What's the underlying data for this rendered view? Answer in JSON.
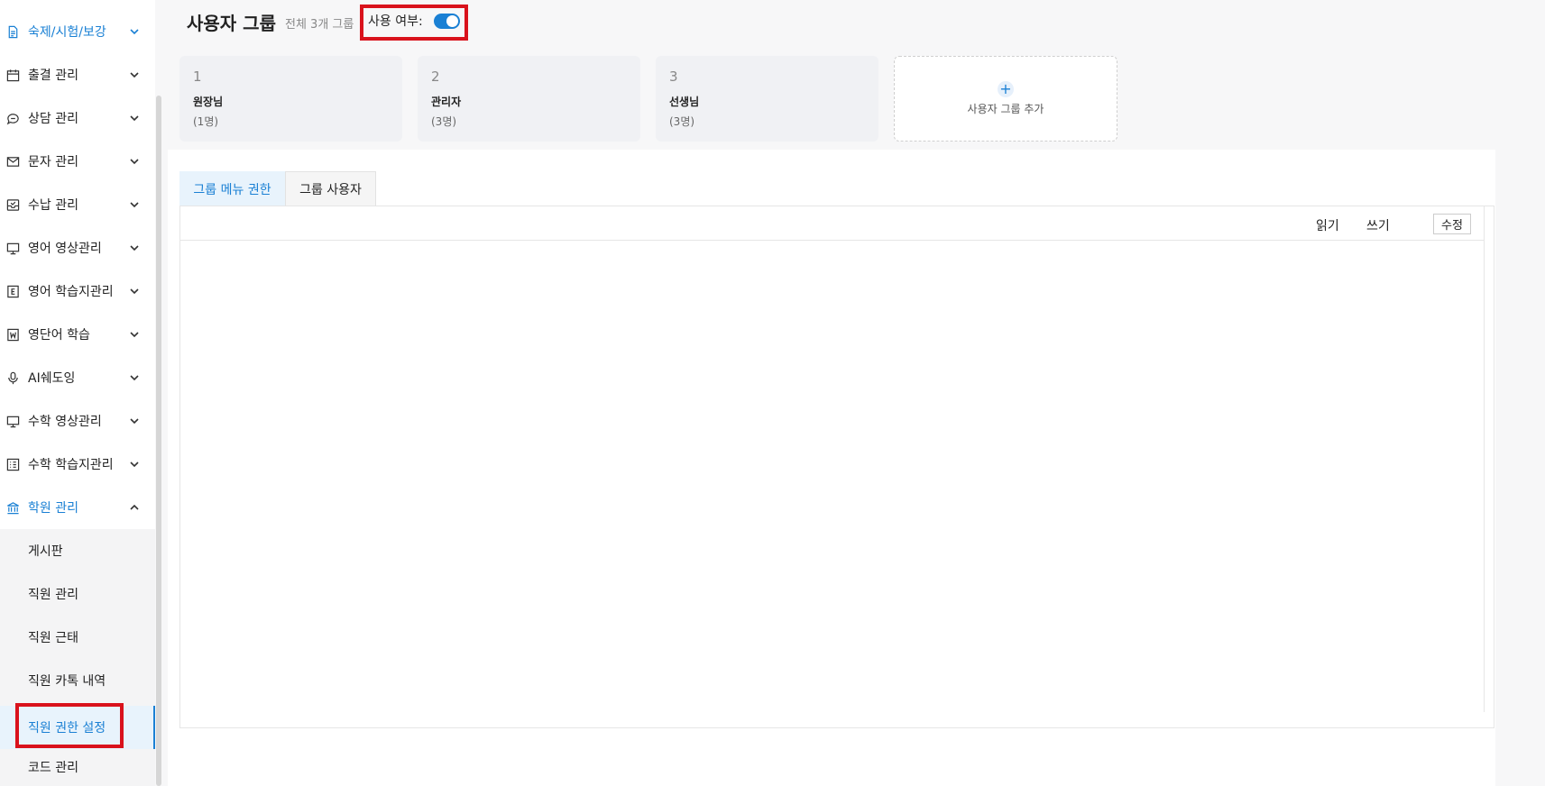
{
  "sidebar": {
    "items": [
      {
        "label": "숙제/시험/보강",
        "icon": "document-icon",
        "expanded": false,
        "active": true
      },
      {
        "label": "출결 관리",
        "icon": "calendar-icon",
        "expanded": false
      },
      {
        "label": "상담 관리",
        "icon": "chat-icon",
        "expanded": false
      },
      {
        "label": "문자 관리",
        "icon": "mail-icon",
        "expanded": false
      },
      {
        "label": "수납 관리",
        "icon": "inbox-icon",
        "expanded": false
      },
      {
        "label": "영어 영상관리",
        "icon": "monitor-icon",
        "expanded": false
      },
      {
        "label": "영어 학습지관리",
        "icon": "e-book-icon",
        "expanded": false
      },
      {
        "label": "영단어 학습",
        "icon": "w-book-icon",
        "expanded": false
      },
      {
        "label": "AI쉐도잉",
        "icon": "microphone-icon",
        "expanded": false
      },
      {
        "label": "수학 영상관리",
        "icon": "monitor-icon",
        "expanded": false
      },
      {
        "label": "수학 학습지관리",
        "icon": "grid-icon",
        "expanded": false
      },
      {
        "label": "학원 관리",
        "icon": "institution-icon",
        "expanded": true,
        "active": true
      }
    ],
    "subitems": [
      {
        "label": "게시판"
      },
      {
        "label": "직원 관리"
      },
      {
        "label": "직원 근태"
      },
      {
        "label": "직원 카톡 내역"
      },
      {
        "label": "직원 권한 설정",
        "active": true
      },
      {
        "label": "코드 관리"
      }
    ]
  },
  "header": {
    "title": "사용자 그룹",
    "count_text": "전체 3개 그룹",
    "use_label": "사용 여부:",
    "use_enabled": true
  },
  "groups": [
    {
      "num": "1",
      "name": "원장님",
      "members": "(1명)"
    },
    {
      "num": "2",
      "name": "관리자",
      "members": "(3명)"
    },
    {
      "num": "3",
      "name": "선생님",
      "members": "(3명)"
    }
  ],
  "add_group_label": "사용자 그룹 추가",
  "tabs": [
    {
      "label": "그룹 메뉴 권한",
      "active": true
    },
    {
      "label": "그룹 사용자",
      "active": false
    }
  ],
  "table": {
    "col_read": "읽기",
    "col_write": "쓰기",
    "edit_label": "수정"
  },
  "colors": {
    "accent": "#1a80d4",
    "highlight_box": "#d9121c"
  }
}
